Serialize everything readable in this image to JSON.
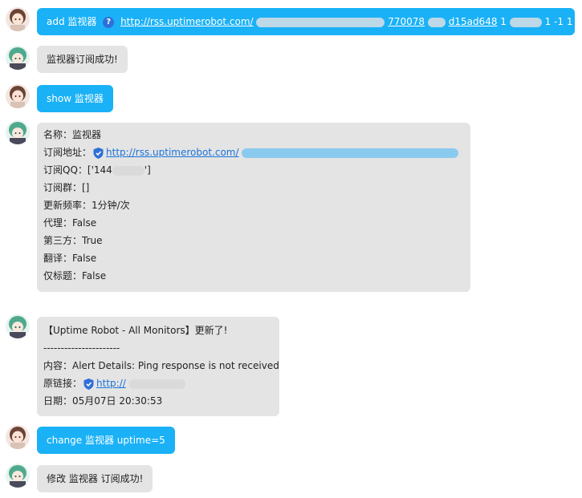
{
  "messages": [
    {
      "prefix": "add 监视器",
      "url": "http://rss.uptimerobot.com/",
      "url_tail": "770078",
      "url_tail2": "d15ad648",
      "suffix": "1",
      "suffix2": "1 -1 1 0 1"
    },
    {
      "text": "监视器订阅成功!"
    },
    {
      "text": "show 监视器"
    },
    {
      "lines": {
        "name": "名称：监视器",
        "url_label": "订阅地址：",
        "url": "http://rss.uptimerobot.com/",
        "qq_label": "订阅QQ：['144",
        "qq_close": "']",
        "group": "订阅群：[]",
        "freq": "更新频率：1分钟/次",
        "proxy": "代理：False",
        "third": "第三方：True",
        "translate": "翻译：False",
        "title_only": "仅标题：False"
      }
    },
    {
      "lines": {
        "header": "【Uptime Robot - All Monitors】更新了!",
        "divider": "----------------------",
        "content": "内容：Alert Details: Ping response is not received.",
        "link_label": "原链接：",
        "link": "http://",
        "date": "日期：05月07日 20:30:53"
      }
    },
    {
      "text": "change 监视器 uptime=5"
    },
    {
      "text": "修改 监视器 订阅成功!"
    }
  ],
  "colors": {
    "user_bubble": "#1ab1f6",
    "bot_bubble": "#e4e4e4",
    "link": "#1a73d9"
  },
  "icons": {
    "user_avatar": "user-avatar-icon",
    "bot_avatar": "bot-avatar-icon",
    "question": "question-circle-icon",
    "shield": "shield-icon"
  }
}
